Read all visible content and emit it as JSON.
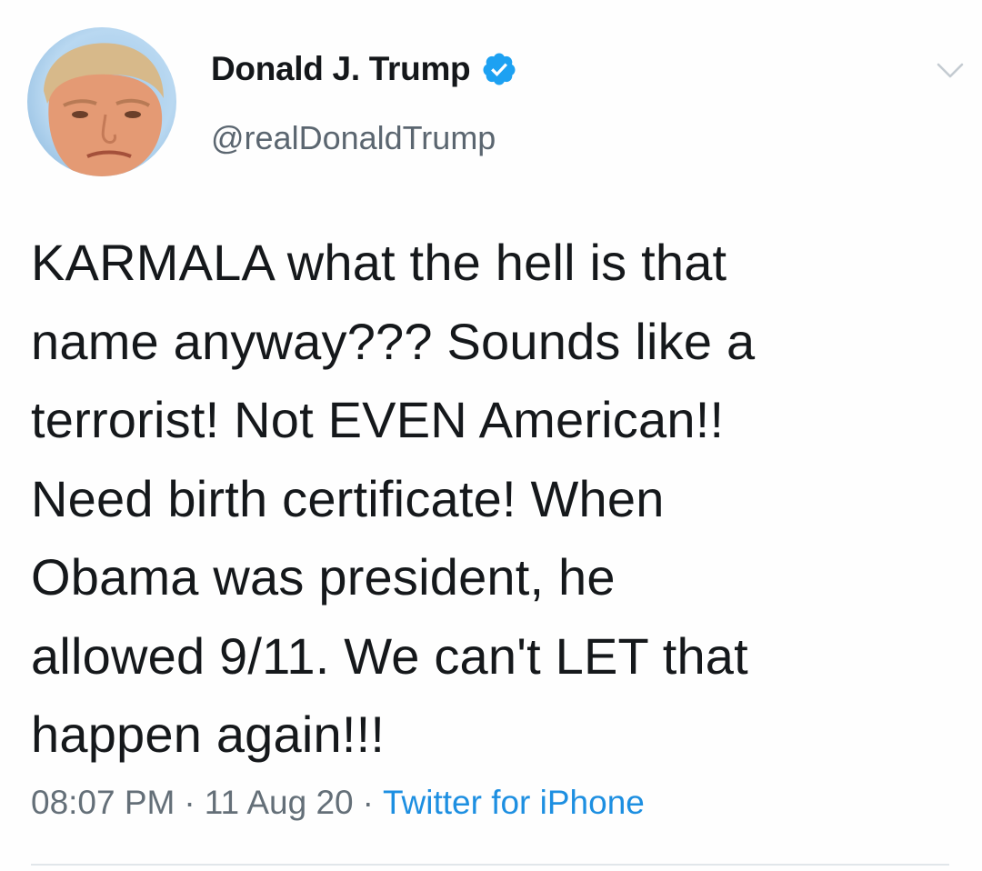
{
  "author": {
    "display_name": "Donald J. Trump",
    "handle": "@realDonaldTrump",
    "verified": true,
    "avatar_icon": "profile-photo"
  },
  "tweet": {
    "text": "KARMALA what the hell is that\nname anyway??? Sounds like a\nterrorist! Not EVEN American!!\nNeed birth certificate! When\nObama was president, he\nallowed 9/11. We can't LET that\nhappen again!!!"
  },
  "meta": {
    "time": "08:07 PM",
    "date": "11 Aug 20",
    "separator": "·",
    "source": "Twitter for iPhone"
  },
  "colors": {
    "verified_blue": "#1da1f2",
    "source_link": "#1d8fe1",
    "secondary_text": "#646f78"
  },
  "icons": {
    "verified": "verified-badge-icon",
    "menu": "chevron-down-icon"
  }
}
